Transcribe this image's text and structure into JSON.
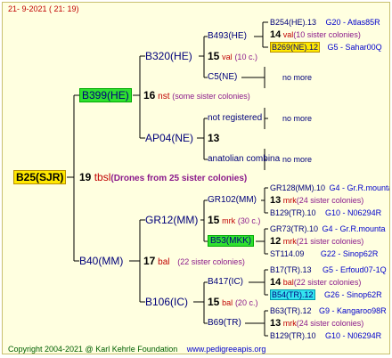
{
  "header": {
    "date": "21-  9-2021 (  21:  19)"
  },
  "root": {
    "name": "B25(SJR)",
    "year": "19",
    "breeder": "tbsl",
    "note": "(Drones from 25 sister colonies)"
  },
  "l1": {
    "upper": {
      "name": "B399(HE)",
      "year": "16",
      "breeder": "nst",
      "note": "(some sister colonies)"
    },
    "lower": {
      "name": "B40(MM)",
      "year": "17",
      "breeder": "bal",
      "note": "(22 sister colonies)"
    }
  },
  "l2": {
    "b320": {
      "name": "B320(HE)"
    },
    "ap04": {
      "name": "AP04(NE)",
      "year": "13"
    },
    "gr12": {
      "name": "GR12(MM)",
      "year": "15",
      "breeder": "mrk",
      "note": "(30 c.)"
    },
    "b106": {
      "name": "B106(IC)",
      "year": "15",
      "breeder": "bal",
      "note": "(20 c.)"
    }
  },
  "l3": {
    "b493": {
      "name": "B493(HE)",
      "year": "15",
      "breeder": "val",
      "note": "(10 c.)"
    },
    "c5": {
      "name": "C5(NE)"
    },
    "notreg": {
      "name": "not registered"
    },
    "anat": {
      "name": "anatolian combina"
    },
    "gr102": {
      "name": "GR102(MM)"
    },
    "b53": {
      "name": "B53(MKK)",
      "year": "12",
      "breeder": "mrk",
      "note": "(21 sister colonies)"
    },
    "b417": {
      "name": "B417(IC)",
      "year": "14",
      "breeder": "bal",
      "note": "(22 sister colonies)"
    },
    "b69": {
      "name": "B69(TR)"
    }
  },
  "l4": {
    "r1": {
      "name": "B254(HE).13",
      "code": "G20 - Atlas85R"
    },
    "r2": {
      "year": "14",
      "breeder": "val",
      "note": "(10 sister colonies)"
    },
    "r3": {
      "name": "B269(NE).12",
      "code": "G5 - Sahar00Q"
    },
    "r4": {
      "text": "no more"
    },
    "r5": {
      "text": "no more"
    },
    "r6": {
      "text": "no more"
    },
    "r7": {
      "name": "GR128(MM).10",
      "code": "G4 - Gr.R.mounta"
    },
    "r8": {
      "year": "13",
      "breeder": "mrk",
      "note": "(24 sister colonies)"
    },
    "r9": {
      "name": "B129(TR).10",
      "code": "G10 - N06294R"
    },
    "r10": {
      "name": "GR73(TR).10",
      "code": "G4 - Gr.R.mounta"
    },
    "r11": {
      "name": "ST114.09",
      "code": "G22 - Sinop62R"
    },
    "r12": {
      "name": "B17(TR).13",
      "code": "G5 - Erfoud07-1Q"
    },
    "r13": {
      "year": "14",
      "breeder": "bal",
      "note": "(22 sister colonies)"
    },
    "r14": {
      "name": "B54(TR).12",
      "code": "G26 - Sinop62R"
    },
    "r15": {
      "name": "B63(TR).12",
      "code": "G9 - Kangaroo98R"
    },
    "r16": {
      "year": "13",
      "breeder": "mrk",
      "note": "(24 sister colonies)"
    },
    "r17": {
      "name": "B129(TR).10",
      "code": "G10 - N06294R"
    }
  },
  "footer": {
    "copyright": "Copyright 2004-2021 @ Karl Kehrle Foundation",
    "site": "www.pedigreeapis.org"
  }
}
